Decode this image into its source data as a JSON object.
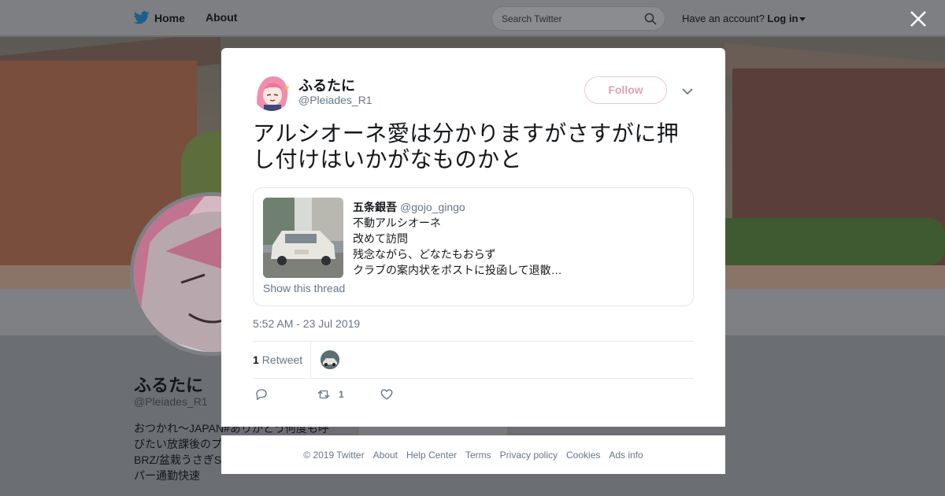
{
  "topbar": {
    "home_label": "Home",
    "about_label": "About",
    "search_placeholder": "Search Twitter",
    "account_prompt": "Have an account?",
    "login_label": "Log in"
  },
  "background_profile": {
    "name": "ふるたに",
    "handle": "@Pleiades_R1",
    "bio_lines": [
      "おつかれ〜JAPAN#ありがとう何度も呼",
      "びたい放課後のプ",
      "BRZ/盆栽うさぎS",
      "パー通勤快速"
    ]
  },
  "tweet": {
    "author_name": "ふるたに",
    "author_handle": "@Pleiades_R1",
    "follow_label": "Follow",
    "text": "アルシオーネ愛は分かりますがさすがに押し付けはいかがなものかと",
    "quoted": {
      "author_name": "五条銀吾",
      "author_handle": "@gojo_gingo",
      "lines": [
        "不動アルシオーネ",
        "改めて訪問",
        "残念ながら、どなたもおらず",
        "クラブの案内状をポストに投函して退散…"
      ],
      "show_thread_label": "Show this thread"
    },
    "timestamp": "5:52 AM - 23 Jul 2019",
    "retweet_count": "1",
    "retweet_label": "Retweet",
    "actions": {
      "retweet_count": "1"
    }
  },
  "footer": {
    "copyright": "© 2019 Twitter",
    "links": [
      "About",
      "Help Center",
      "Terms",
      "Privacy policy",
      "Cookies",
      "Ads info"
    ]
  },
  "colors": {
    "follow_border": "#f3c3c9",
    "follow_text": "#e0a3ab",
    "muted_text": "#657786",
    "twitter_blue": "#1da1f2"
  }
}
